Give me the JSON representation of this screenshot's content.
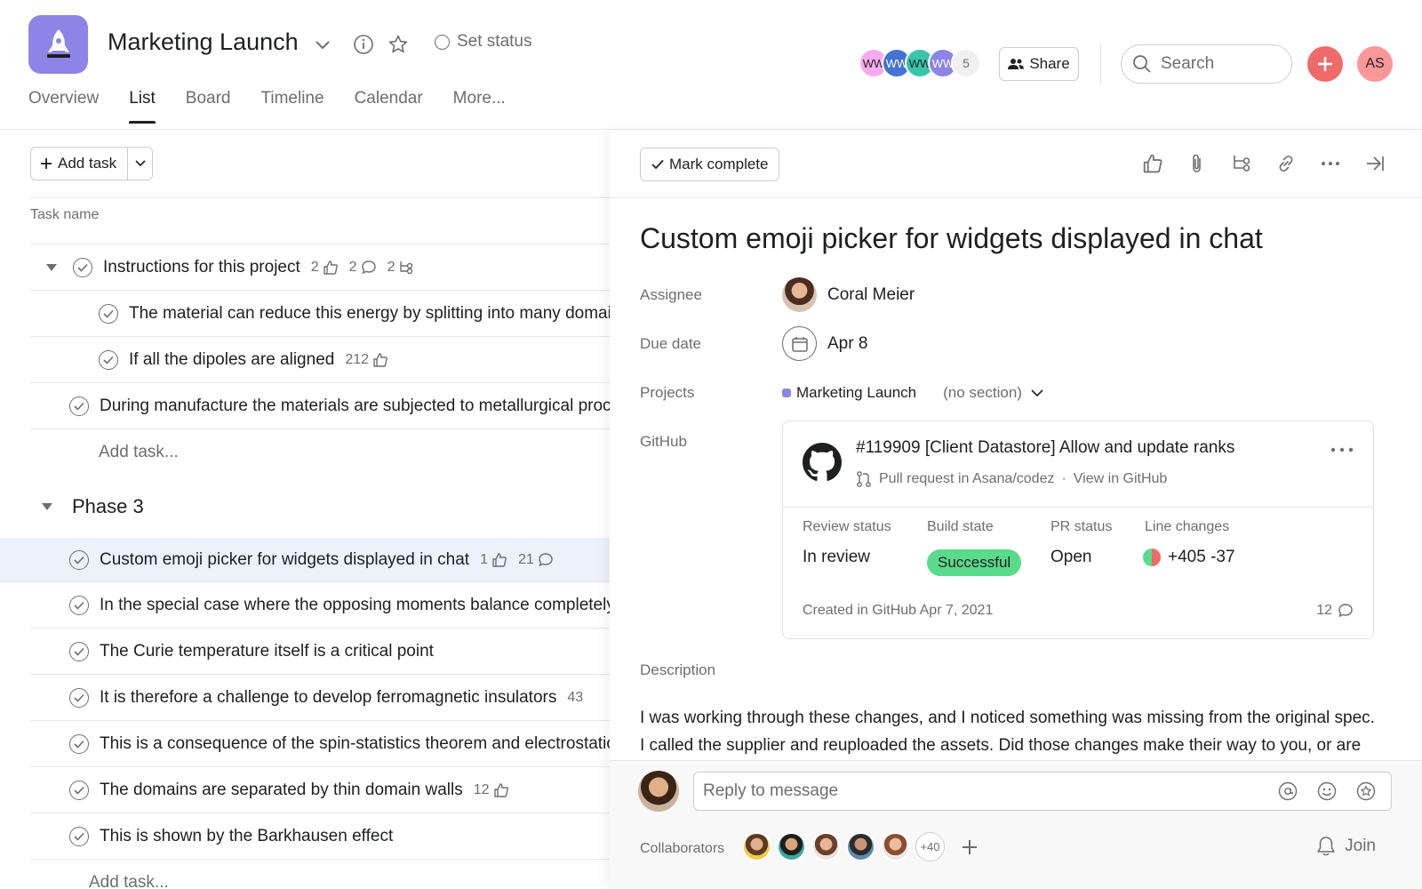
{
  "header": {
    "project_icon": "rocket-icon",
    "project_title": "Marketing Launch",
    "set_status": "Set status",
    "tabs": [
      "Overview",
      "List",
      "Board",
      "Timeline",
      "Calendar",
      "More..."
    ],
    "active_tab": "List",
    "members": [
      {
        "initials": "WW",
        "color": "#f9aaef"
      },
      {
        "initials": "WW",
        "color": "#4573d2"
      },
      {
        "initials": "WW",
        "color": "#37c5ab"
      },
      {
        "initials": "WW",
        "color": "#8d84e8"
      }
    ],
    "member_count": "5",
    "share_label": "Share",
    "search_placeholder": "Search",
    "user_initials": "AS"
  },
  "list": {
    "add_task_label": "Add task",
    "column_task_name": "Task name",
    "section1": {
      "parent": {
        "name": "Instructions for this project",
        "likes": "2",
        "comments": "2",
        "subtasks": "2"
      },
      "subtasks": [
        {
          "name": "The material can reduce this energy by splitting into many domains"
        },
        {
          "name": "If all the dipoles are aligned",
          "likes": "212"
        }
      ],
      "task": {
        "name": "During manufacture the materials are subjected to metallurgical processes"
      },
      "add_task": "Add task..."
    },
    "section2": {
      "title": "Phase 3",
      "tasks": [
        {
          "name": "Custom emoji picker for widgets displayed in chat",
          "likes": "1",
          "comments": "21"
        },
        {
          "name": "In the special case where the opposing moments balance completely"
        },
        {
          "name": "The Curie temperature itself is a critical point"
        },
        {
          "name": "It is therefore a challenge to develop ferromagnetic insulators",
          "likes": "43"
        },
        {
          "name": "This is a consequence of the spin-statistics theorem and electrostatic repulsion"
        },
        {
          "name": "The domains are separated by thin domain walls",
          "likes": "12"
        },
        {
          "name": "This is shown by the Barkhausen effect"
        }
      ],
      "add_task": "Add task..."
    }
  },
  "detail": {
    "mark_complete": "Mark complete",
    "title": "Custom emoji picker for widgets displayed in chat",
    "labels": {
      "assignee": "Assignee",
      "due_date": "Due date",
      "projects": "Projects",
      "github": "GitHub",
      "description": "Description"
    },
    "assignee": "Coral Meier",
    "due_date": "Apr 8",
    "project": "Marketing Launch",
    "section": "(no section)",
    "github": {
      "pr_title": "#119909 [Client Datastore] Allow and update ranks",
      "pr_sub": "Pull request in Asana/codez",
      "pr_link": "View in GitHub",
      "cols": {
        "review": "Review status",
        "build": "Build state",
        "pr": "PR status",
        "lines": "Line changes"
      },
      "review_status": "In review",
      "build_state": "Successful",
      "pr_status": "Open",
      "line_changes": "+405 -37",
      "created": "Created in GitHub Apr 7, 2021",
      "comment_count": "12"
    },
    "description": "I was working through these changes, and I noticed something was missing from the original spec. I called the supplier and reuploaded the assets. Did those changes make their way to you, or are you still waiting? I was working through these changes, and I noticed something",
    "reply_placeholder": "Reply to message",
    "collaborators_label": "Collaborators",
    "collaborators_more": "+40",
    "join_label": "Join"
  },
  "colors": {
    "accent": "#f06a6a",
    "project": "#8d84e8",
    "success": "#5ada8b",
    "selected_row": "#edf1fc"
  }
}
